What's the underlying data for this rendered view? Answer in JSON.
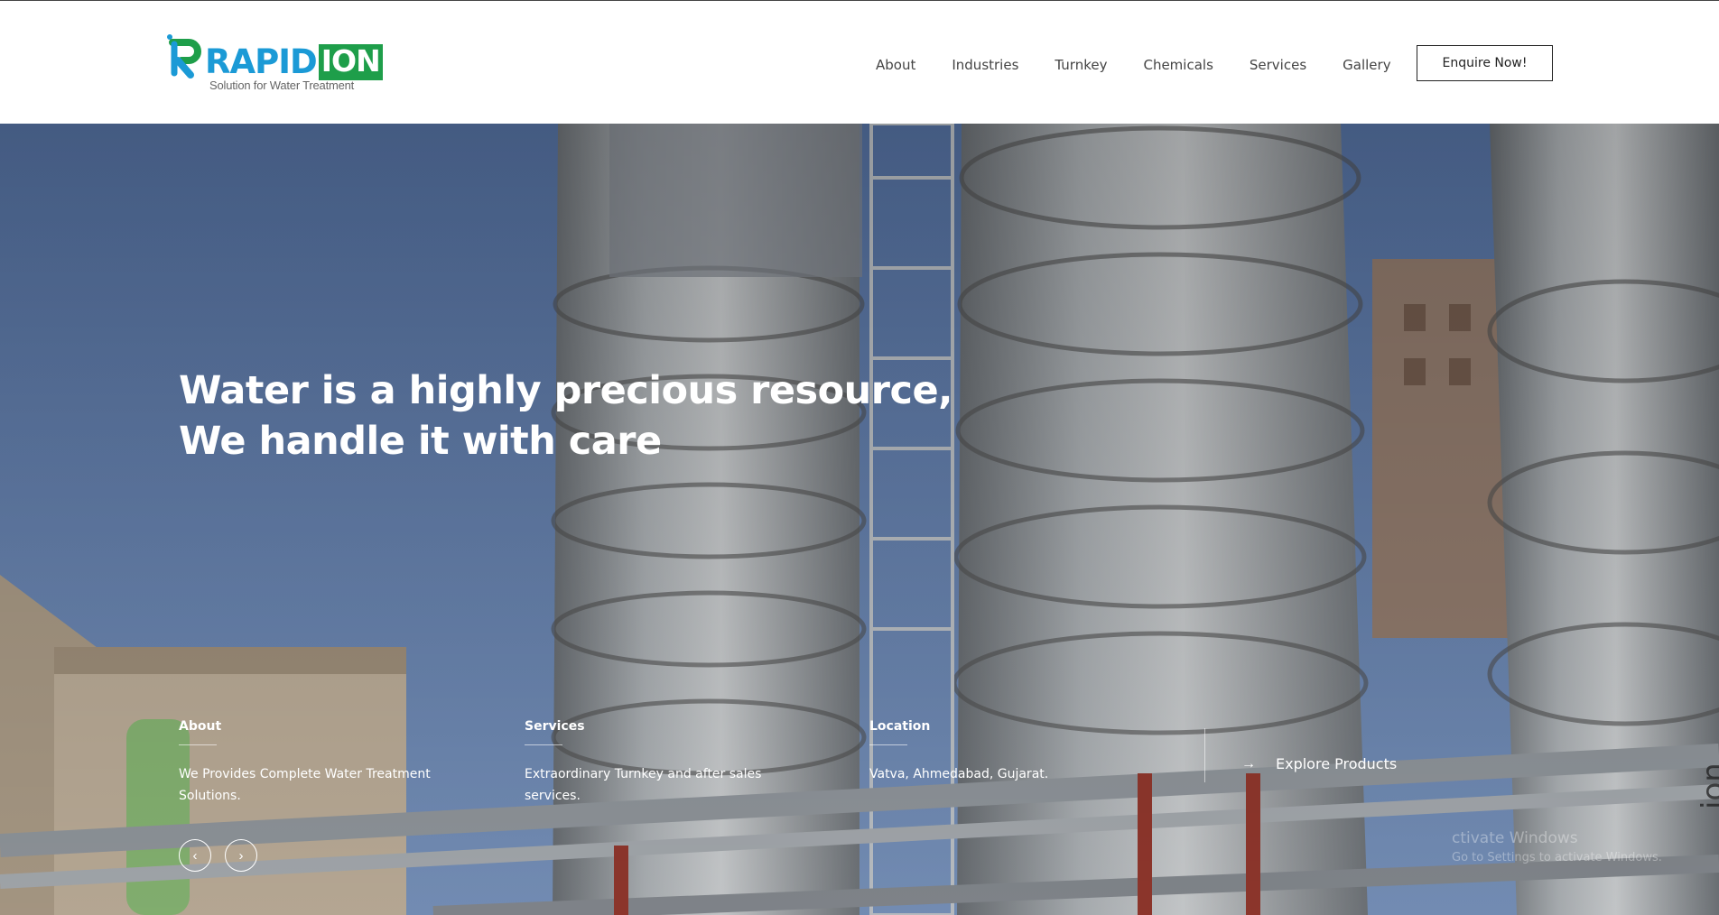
{
  "header": {
    "logo": {
      "brand_main": "RAPID",
      "brand_accent": "ION",
      "tagline": "Solution for Water Treatment"
    },
    "nav": [
      "About",
      "Industries",
      "Turnkey",
      "Chemicals",
      "Services",
      "Gallery"
    ],
    "cta": "Enquire Now!"
  },
  "hero": {
    "title_line1": "Water is a highly precious resource,",
    "title_line2": "We handle it with care",
    "info": [
      {
        "heading": "About",
        "text": "We Provides Complete Water Treatment Solutions."
      },
      {
        "heading": "Services",
        "text": "Extraordinary Turnkey and after sales services."
      },
      {
        "heading": "Location",
        "text": "Vatva, Ahmedabad, Gujarat."
      }
    ],
    "explore_label": "Explore Products",
    "explore_icon": "arrow-right-icon",
    "prev_icon": "chevron-left-icon",
    "next_icon": "chevron-right-icon",
    "side_text": "ion"
  },
  "os_watermark": {
    "line1": "ctivate Windows",
    "line2": "Go to Settings to activate Windows."
  },
  "colors": {
    "brand_blue": "#1b9ad6",
    "brand_green": "#1e9e4a",
    "sky": "#5d7fb0"
  }
}
